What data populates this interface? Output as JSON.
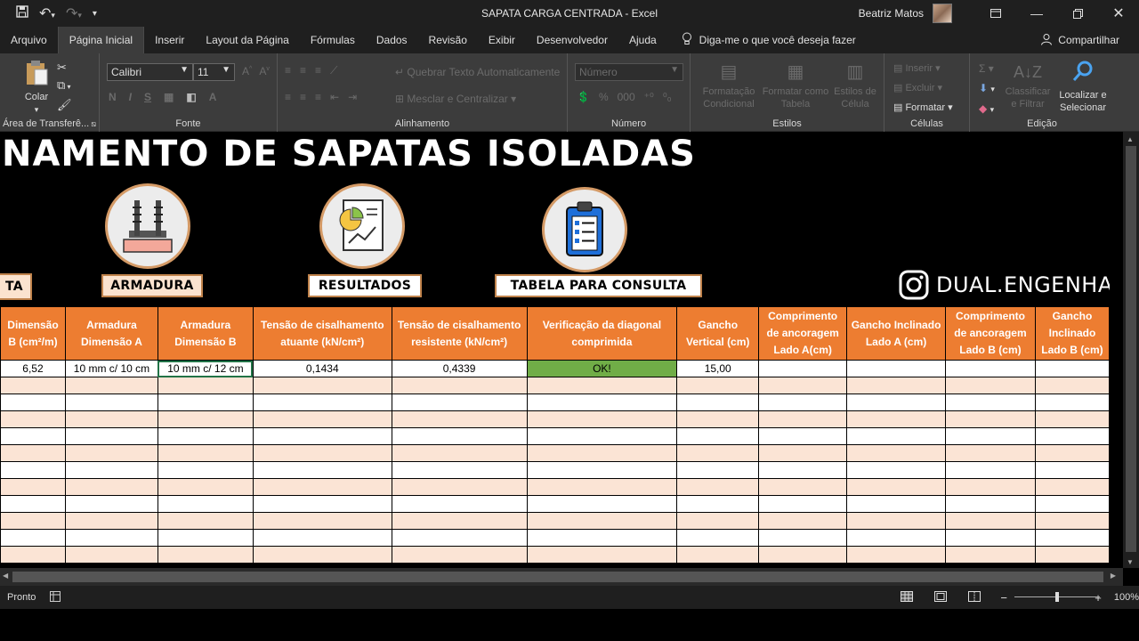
{
  "window": {
    "title": "SAPATA CARGA CENTRADA  -  Excel",
    "user": "Beatriz Matos"
  },
  "menu": {
    "tabs": [
      "Arquivo",
      "Página Inicial",
      "Inserir",
      "Layout da Página",
      "Fórmulas",
      "Dados",
      "Revisão",
      "Exibir",
      "Desenvolvedor",
      "Ajuda"
    ],
    "tell_me": "Diga-me o que você deseja fazer",
    "share": "Compartilhar"
  },
  "ribbon": {
    "clipboard": {
      "paste": "Colar",
      "label": "Área de Transferê..."
    },
    "font": {
      "name": "Calibri",
      "size": "11",
      "label": "Fonte"
    },
    "alignment": {
      "wrap": "Quebrar Texto Automaticamente",
      "merge": "Mesclar e Centralizar",
      "label": "Alinhamento"
    },
    "number": {
      "format": "Número",
      "label": "Número"
    },
    "styles": {
      "cond": "Formatação Condicional",
      "table": "Formatar como Tabela",
      "cell": "Estilos de Célula",
      "label": "Estilos"
    },
    "cells": {
      "insert": "Inserir",
      "delete": "Excluir",
      "format": "Formatar",
      "label": "Células"
    },
    "editing": {
      "sort": "Classificar e Filtrar",
      "find": "Localizar e Selecionar",
      "label": "Edição"
    }
  },
  "sheet": {
    "banner_title": "NAMENTO DE SAPATAS ISOLADAS",
    "buttons": {
      "left": "TA",
      "armadura": "ARMADURA",
      "resultados": "RESULTADOS",
      "tabela": "TABELA PARA CONSULTA"
    },
    "instagram": "DUAL.ENGENHARIA",
    "headers": [
      "Dimensão B (cm²/m)",
      "Armadura Dimensão A",
      "Armadura Dimensão B",
      "Tensão de cisalhamento atuante (kN/cm²)",
      "Tensão de cisalhamento resistente (kN/cm²)",
      "Verificação da diagonal comprimida",
      "Gancho Vertical (cm)",
      "Comprimento de ancoragem Lado A(cm)",
      "Gancho Inclinado Lado A (cm)",
      "Comprimento de ancoragem Lado B (cm)",
      "Gancho Inclinado Lado B (cm)"
    ],
    "row1": [
      "6,52",
      "10 mm c/ 10 cm",
      "10 mm c/ 12 cm",
      "0,1434",
      "0,4339",
      "OK!",
      "15,00",
      "",
      "",
      "",
      ""
    ]
  },
  "status": {
    "ready": "Pronto",
    "zoom": "100%"
  },
  "colors": {
    "header_orange": "#ED7D31",
    "ok_green": "#70AD47",
    "band": "#FBE4D5"
  }
}
